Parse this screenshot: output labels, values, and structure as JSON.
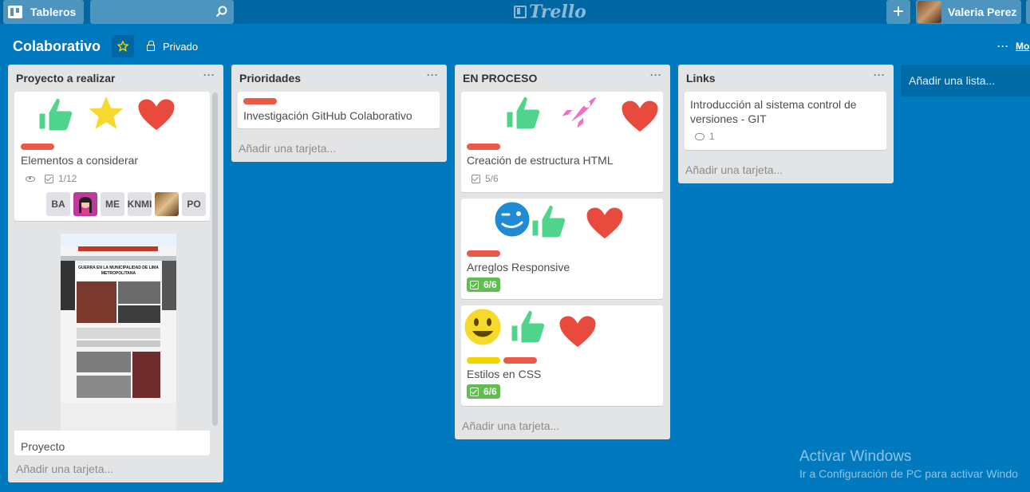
{
  "header": {
    "boards_label": "Tableros",
    "search_placeholder": "",
    "logo_text": "Trello",
    "user_name": "Valeria Perez"
  },
  "board": {
    "title": "Colaborativo",
    "privacy": "Privado",
    "more_label": "Mo"
  },
  "lists": [
    {
      "title": "Proyecto a realizar",
      "add_card": "Añadir una tarjeta...",
      "cards": [
        {
          "title": "Elementos a considerar",
          "checklist": "1/12",
          "members": [
            "BA",
            "ME",
            "KNMI",
            "PO"
          ]
        },
        {
          "title": "Proyecto"
        }
      ]
    },
    {
      "title": "Prioridades",
      "add_card": "Añadir una tarjeta...",
      "cards": [
        {
          "title": "Investigación GitHub Colaborativo"
        }
      ]
    },
    {
      "title": "EN PROCESO",
      "add_card": "Añadir una tarjeta...",
      "cards": [
        {
          "title": "Creación de estructura HTML",
          "checklist": "5/6"
        },
        {
          "title": "Arreglos Responsive",
          "checklist": "6/6"
        },
        {
          "title": "Estilos en CSS",
          "checklist": "6/6"
        }
      ]
    },
    {
      "title": "Links",
      "add_card": "Añadir una tarjeta...",
      "cards": [
        {
          "title": "Introducción al sistema control de versiones - GIT",
          "comments": "1"
        }
      ]
    }
  ],
  "add_list_label": "Añadir una lista...",
  "thumbnail": {
    "headline": "GUERRA EN LA MUNICIPALIDAD DE LIMA METROPOLITANA"
  },
  "watermark": {
    "line1": "Activar Windows",
    "line2": "Ir a Configuración de PC para activar Windo"
  },
  "colors": {
    "board_bg": "#0079bf",
    "header_bg": "#0067a3",
    "label_red": "#eb5a46",
    "label_yellow": "#f2d600",
    "badge_green": "#61bd4f"
  }
}
